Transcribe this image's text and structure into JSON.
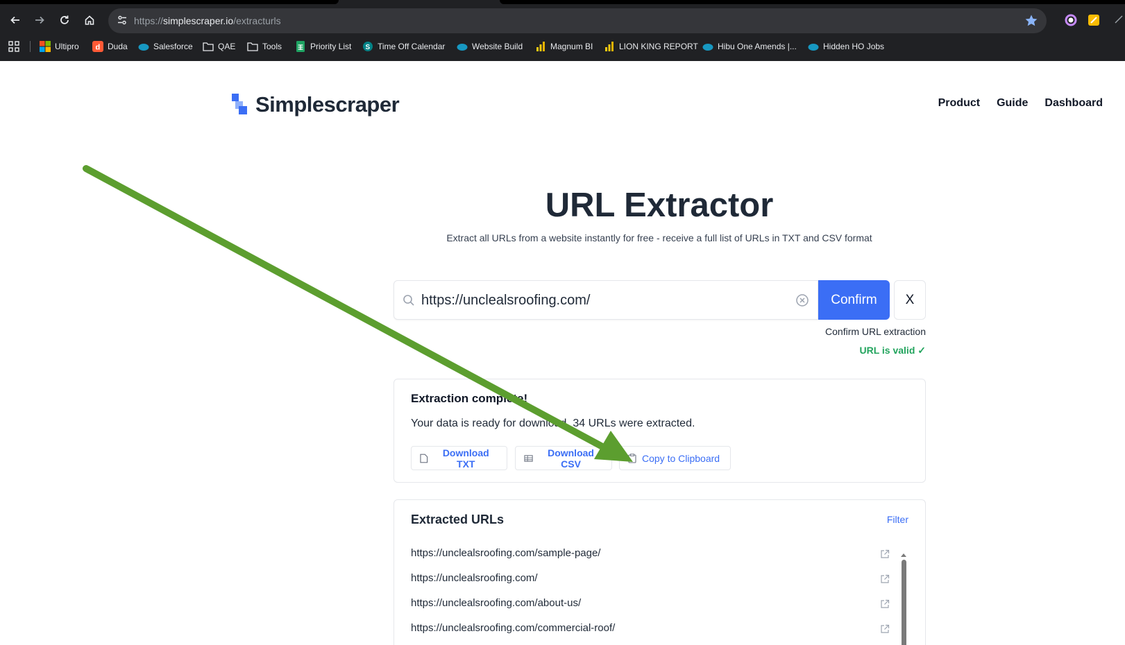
{
  "browser": {
    "url_scheme": "https://",
    "url_host": "simplescraper.io",
    "url_path": "/extracturls",
    "bookmarks": [
      {
        "label": "Ultipro",
        "icon": "windows-logo-icon",
        "color": "#f25022"
      },
      {
        "label": "Duda",
        "icon": "duda-icon",
        "color": "#ff5a36"
      },
      {
        "label": "Salesforce",
        "icon": "cloud-icon",
        "color": "#1798c1"
      },
      {
        "label": "QAE",
        "icon": "folder-icon",
        "color": "#e8eaed"
      },
      {
        "label": "Tools",
        "icon": "folder-icon",
        "color": "#e8eaed"
      },
      {
        "label": "Priority List",
        "icon": "sheets-icon",
        "color": "#1ea362"
      },
      {
        "label": "Time Off Calendar",
        "icon": "sharepoint-icon",
        "color": "#038387"
      },
      {
        "label": "Website Build",
        "icon": "cloud-icon",
        "color": "#1798c1"
      },
      {
        "label": "Magnum BI",
        "icon": "powerbi-icon",
        "color": "#f2c811"
      },
      {
        "label": "LION KING REPORT",
        "icon": "powerbi-icon",
        "color": "#f2c811"
      },
      {
        "label": "Hibu One Amends |...",
        "icon": "cloud-icon",
        "color": "#1798c1"
      },
      {
        "label": "Hidden HO Jobs",
        "icon": "cloud-icon",
        "color": "#1798c1"
      }
    ]
  },
  "site": {
    "brand": "Simplescraper",
    "nav": [
      "Product",
      "Guide",
      "Dashboard"
    ]
  },
  "hero": {
    "title": "URL Extractor",
    "subtitle": "Extract all URLs from a website instantly for free - receive a full list of URLs in TXT and CSV format"
  },
  "search": {
    "value": "https://unclealsroofing.com/",
    "confirm_label": "Confirm",
    "close_label": "X",
    "hint": "Confirm URL extraction",
    "valid_text": "URL is valid ✓"
  },
  "result": {
    "heading": "Extraction complete!",
    "message": "Your data is ready for download. 34 URLs were extracted.",
    "buttons": {
      "txt": "Download TXT",
      "csv": "Download CSV",
      "clipboard": "Copy to Clipboard"
    }
  },
  "extracted": {
    "heading": "Extracted URLs",
    "filter_label": "Filter",
    "urls": [
      "https://unclealsroofing.com/sample-page/",
      "https://unclealsroofing.com/",
      "https://unclealsroofing.com/about-us/",
      "https://unclealsroofing.com/commercial-roof/"
    ]
  },
  "colors": {
    "accent": "#3b6ef5",
    "valid": "#22a45d",
    "annotation_arrow": "#5c9e2f"
  }
}
